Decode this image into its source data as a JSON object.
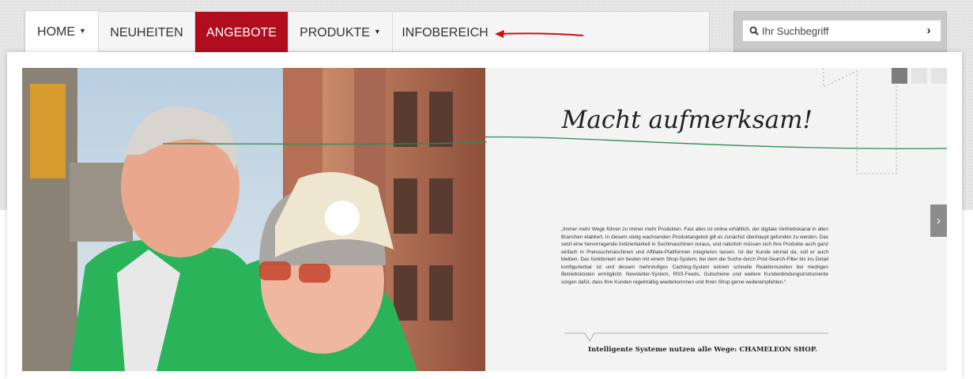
{
  "nav": {
    "items": [
      {
        "label": "HOME",
        "has_dropdown": true
      },
      {
        "label": "NEUHEITEN",
        "has_dropdown": false
      },
      {
        "label": "ANGEBOTE",
        "has_dropdown": false,
        "active_color": "#b00d1f"
      },
      {
        "label": "PRODUKTE",
        "has_dropdown": true
      },
      {
        "label": "INFOBEREICH",
        "has_dropdown": false
      }
    ],
    "annotation_arrow_color": "#cc1111"
  },
  "search": {
    "placeholder": "Ihr Suchbegriff",
    "icon": "search-icon",
    "submit_icon": "chevron-right-icon"
  },
  "slider": {
    "headline": "Macht aufmerksam!",
    "quote": "„Immer mehr Wege führen zu immer mehr Produkten. Fast alles ist online erhältlich, der digitale Vertriebskanal in allen Branchen etabliert. In diesem stetig wachsenden Produktangebot gilt es zunächst überhaupt gefunden zu werden. Das setzt eine hervorragende Indizierbarkeit in Suchmaschinen voraus, und natürlich müssen sich Ihre Produkte auch ganz einfach in Preissuchmaschinen und Affiliate-Plattformen integrieren lassen. Ist der Kunde einmal da, soll er auch bleiben. Das funktioniert am besten mit einem Shop-System, bei dem die Suche durch Post-Search-Filter bis ins Detail konfigurierbar ist und dessen mehrstufiges Caching-System extrem schnelle Reaktionszeiten bei niedrigen Betriebskosten ermöglicht. Newsletter-System, RSS-Feeds, Gutscheine und weitere Kundenbindungsinstrumente sorgen dafür, dass Ihre Kunden regelmäßig wiederkommen und Ihren Shop gerne weiterempfehlen.“",
    "tagline": "Intelligente Systeme nutzen alle Wege: CHAMELEON SHOP.",
    "thumb_count": 3,
    "active_thumb": 1,
    "accent_line_color": "#2e8b57",
    "next_icon": "chevron-right-icon"
  }
}
